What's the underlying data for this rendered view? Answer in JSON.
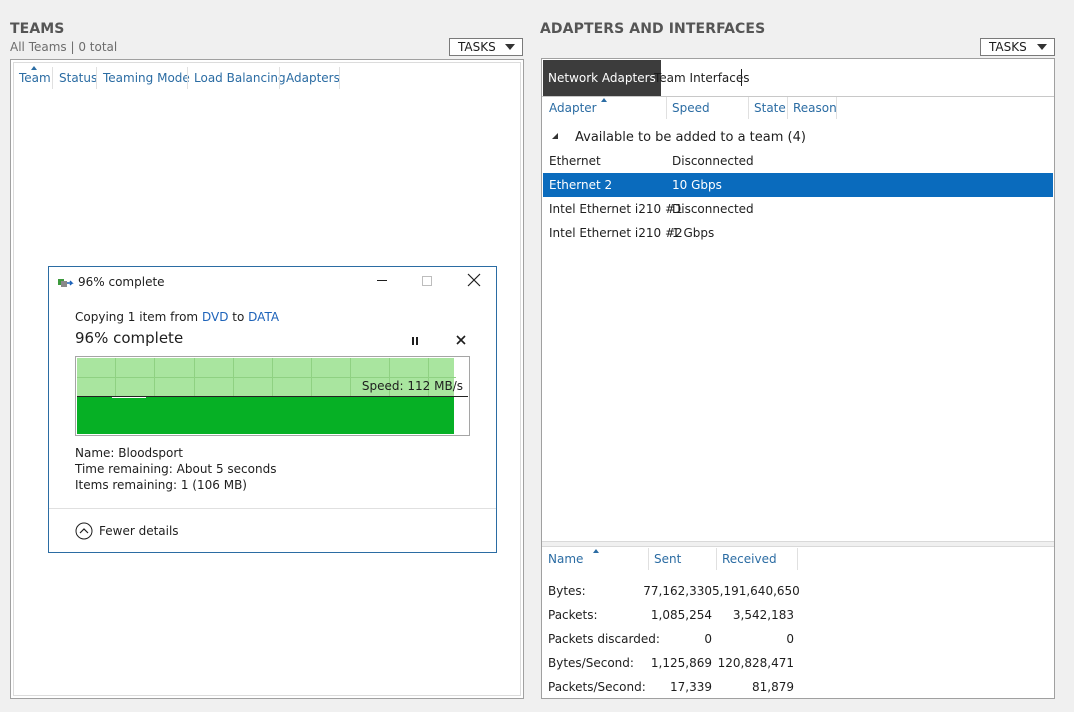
{
  "teams": {
    "title": "TEAMS",
    "subtitle": "All Teams | 0 total",
    "tasks_label": "TASKS",
    "columns": [
      "Team",
      "Status",
      "Teaming Mode",
      "Load Balancing",
      "Adapters"
    ]
  },
  "adapters": {
    "title": "ADAPTERS AND INTERFACES",
    "tasks_label": "TASKS",
    "tabs": [
      "Network Adapters",
      "Team Interfaces"
    ],
    "columns": [
      "Adapter",
      "Speed",
      "State",
      "Reason"
    ],
    "group_label": "Available to be added to a team (4)",
    "rows": [
      {
        "adapter": "Ethernet",
        "speed": "Disconnected",
        "selected": false
      },
      {
        "adapter": "Ethernet 2",
        "speed": "10 Gbps",
        "selected": true
      },
      {
        "adapter": "Intel Ethernet i210 #1",
        "speed": "Disconnected",
        "selected": false
      },
      {
        "adapter": "Intel Ethernet i210 #2",
        "speed": "1 Gbps",
        "selected": false
      }
    ],
    "stats_columns": [
      "Name",
      "Sent",
      "Received"
    ],
    "stats": [
      {
        "name": "Bytes:",
        "sent": "77,162,330",
        "received": "5,191,640,650"
      },
      {
        "name": "Packets:",
        "sent": "1,085,254",
        "received": "3,542,183"
      },
      {
        "name": "Packets discarded:",
        "sent": "0",
        "received": "0"
      },
      {
        "name": "Bytes/Second:",
        "sent": "1,125,869",
        "received": "120,828,471"
      },
      {
        "name": "Packets/Second:",
        "sent": "17,339",
        "received": "81,879"
      }
    ]
  },
  "copy_dialog": {
    "title": "96% complete",
    "copying_prefix": "Copying 1 item from",
    "source": "DVD",
    "to_word": "to",
    "dest": "DATA",
    "heading": "96% complete",
    "progress_percent": 96,
    "speed": "Speed: 112 MB/s",
    "name_label": "Name:",
    "name_value": "Bloodsport",
    "time_label": "Time remaining:",
    "time_value": "About 5 seconds",
    "items_label": "Items remaining:",
    "items_value": "1 (106 MB)",
    "fewer_details": "Fewer details"
  },
  "colors": {
    "accent": "#0a6bbd",
    "progress_fill": "#06b025",
    "progress_light": "#a9e59f"
  }
}
